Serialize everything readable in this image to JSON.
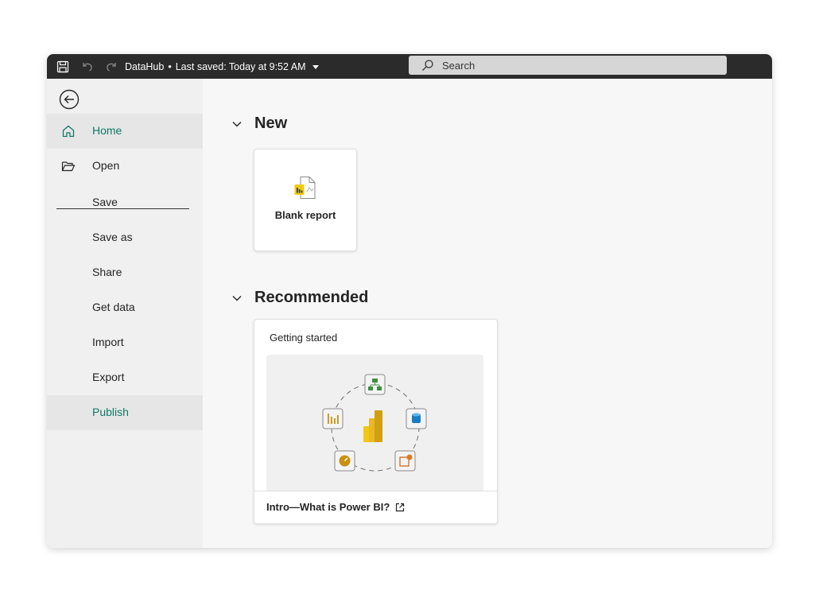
{
  "titlebar": {
    "doc_name": "DataHub",
    "separator": "•",
    "last_saved": "Last saved: Today at 9:52 AM",
    "search_placeholder": "Search",
    "icons": [
      "save-icon",
      "undo-icon",
      "redo-icon",
      "chevron-down-icon",
      "search-icon"
    ]
  },
  "sidebar": {
    "back_icon": "back-arrow-icon",
    "items": [
      {
        "label": "Home",
        "icon": "home-icon",
        "state": "selected"
      },
      {
        "label": "Open",
        "icon": "folder-open-icon"
      },
      {
        "label": "Save"
      },
      {
        "label": "Save as"
      },
      {
        "label": "Share"
      },
      {
        "label": "Get data"
      },
      {
        "label": "Import"
      },
      {
        "label": "Export"
      },
      {
        "label": "Publish",
        "state": "hover"
      }
    ]
  },
  "main": {
    "new_section": {
      "title": "New",
      "cards": [
        {
          "label": "Blank report",
          "icon": "report-document-icon"
        }
      ]
    },
    "recommended_section": {
      "title": "Recommended",
      "card": {
        "title": "Getting started",
        "link_text": "Intro—What is Power BI?",
        "link_icon": "open-external-icon",
        "illustration_icons": [
          "hierarchy-icon",
          "database-icon",
          "add-visual-icon",
          "gauge-icon",
          "bar-chart-icon",
          "power-bi-logo-icon"
        ]
      }
    }
  },
  "colors": {
    "titlebar_bg": "#2b2b2b",
    "accent": "#117865",
    "sidebar_bg": "#f0f0f0",
    "content_bg": "#f7f7f7"
  }
}
